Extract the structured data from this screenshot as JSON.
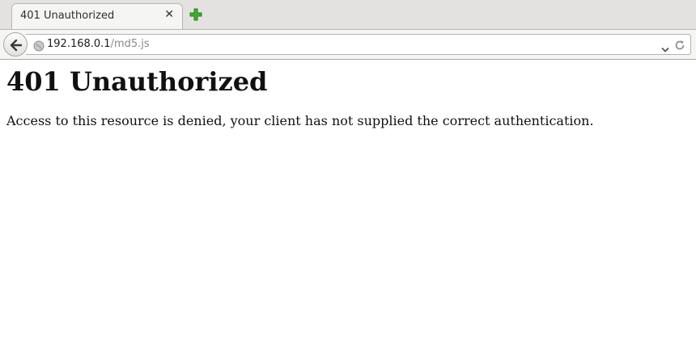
{
  "tab": {
    "title": "401 Unauthorized",
    "close_icon": "close-icon",
    "new_tab_icon": "plus-icon",
    "new_tab_color": "#3cb02a"
  },
  "navbar": {
    "back_icon": "back-arrow-icon",
    "site_icon": "globe-icon",
    "url_host": "192.168.0.1",
    "url_path": "/md5.js",
    "dropdown_icon": "chevron-down-icon",
    "reload_icon": "reload-icon"
  },
  "page": {
    "heading": "401 Unauthorized",
    "message": "Access to this resource is denied, your client has not supplied the correct authentication."
  }
}
